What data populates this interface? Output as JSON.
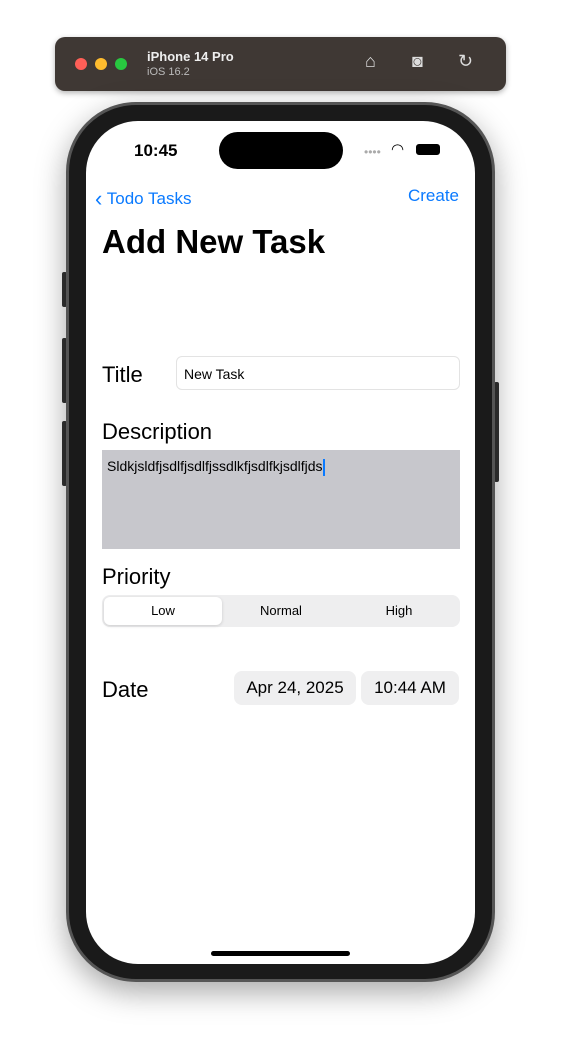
{
  "simulator": {
    "device": "iPhone 14 Pro",
    "os": "iOS 16.2",
    "icons": [
      "home-icon",
      "screenshot-icon",
      "rotate-icon"
    ]
  },
  "status_bar": {
    "time": "10:45"
  },
  "nav": {
    "back_label": "Todo Tasks",
    "create_label": "Create"
  },
  "page_title": "Add New Task",
  "form": {
    "title_label": "Title",
    "title_value": "New Task",
    "description_label": "Description",
    "description_value": "Sldkjsldfjsdlfjsdlfjssdlkfjsdlfkjsdlfjds",
    "priority_label": "Priority",
    "priority_options": [
      "Low",
      "Normal",
      "High"
    ],
    "priority_selected": "Low",
    "date_label": "Date",
    "date_value": "Apr 24, 2025",
    "time_value": "10:44 AM"
  },
  "colors": {
    "accent": "#0a7aff"
  }
}
